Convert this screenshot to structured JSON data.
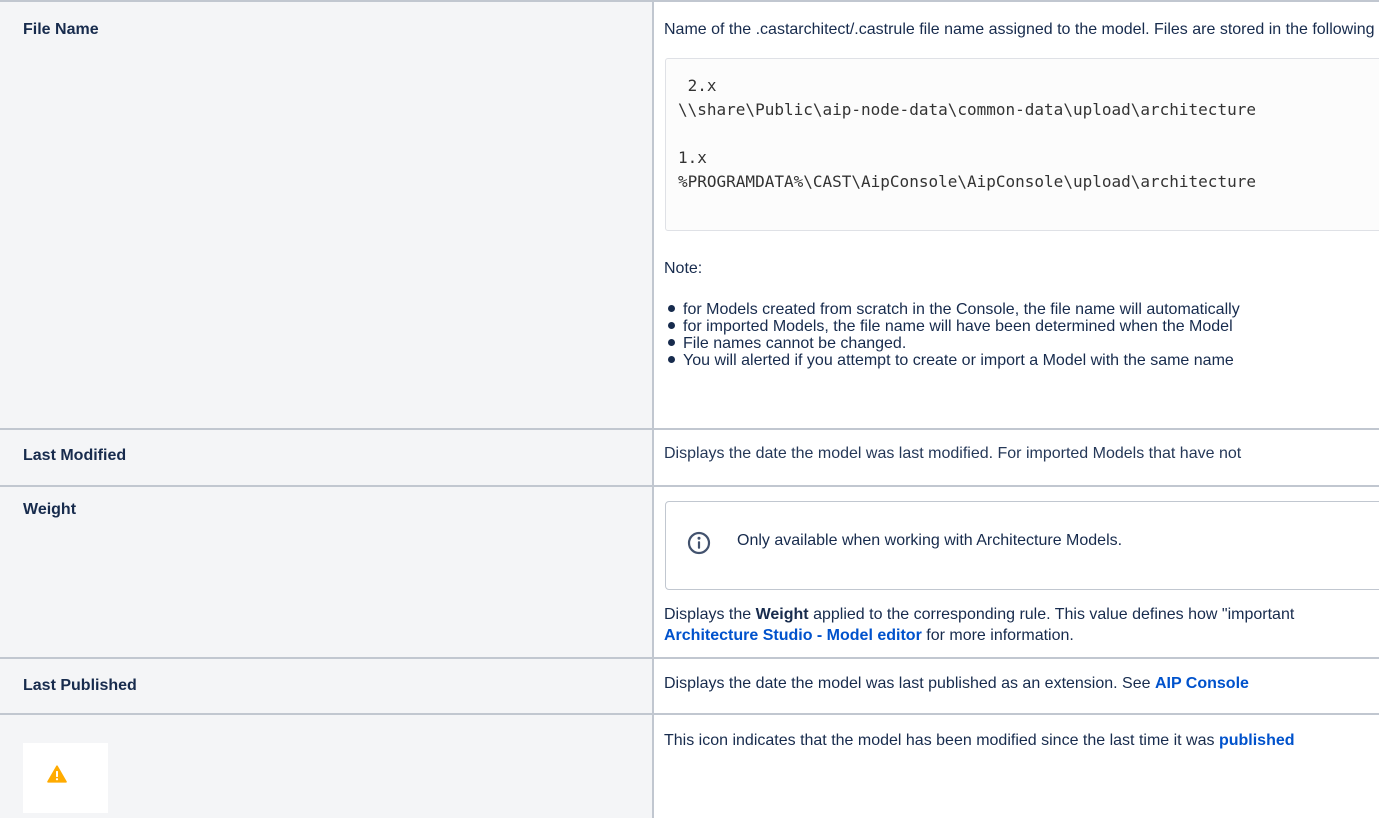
{
  "rows": [
    {
      "label": "File Name",
      "description": "Name of the .castarchitect/.castrule file name assigned to the model. Files are stored in the following locations:",
      "code_lines": [
        " 2.x",
        "\\\\share\\Public\\aip-node-data\\common-data\\upload\\architecture",
        "",
        "1.x",
        "%PROGRAMDATA%\\CAST\\AipConsole\\AipConsole\\upload\\architecture"
      ],
      "note_label": "Note:",
      "bullets": [
        "for Models created from scratch in the Console, the file name will automatically",
        "for imported Models, the file name will have been determined when the Model",
        "File names cannot be changed.",
        "You will alerted if you attempt to create or import a Model with the same name"
      ]
    },
    {
      "label": "Last Modified",
      "description": "Displays the date the model was last modified. For imported Models that have not"
    },
    {
      "label": "Weight",
      "info_text": "Only available when working with Architecture Models.",
      "desc_prefix": "Displays the ",
      "desc_bold": "Weight",
      "desc_suffix": " applied to the corresponding rule. This value defines how \"important",
      "link_text": "Architecture Studio - Model editor",
      "link_suffix": " for more information."
    },
    {
      "label": "Last Published",
      "description": "Displays the date the model was last published as an extension. See ",
      "link_text": "AIP Console"
    },
    {
      "icon": "warning-icon",
      "description": "This icon indicates that the model has been modified since the last time it was ",
      "link_text": "published"
    }
  ],
  "colors": {
    "header_bg": "#f4f5f7",
    "border": "#c1c7d0",
    "link": "#0052cc",
    "text": "#172b4d",
    "info": "#42526e",
    "warning": "#ffab00"
  }
}
